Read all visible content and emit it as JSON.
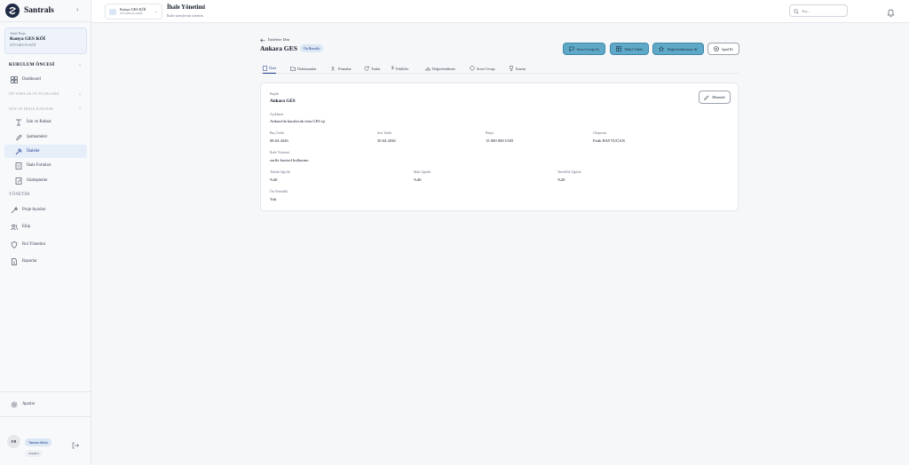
{
  "brand": {
    "name": "Santrals",
    "collapse_icon": "chevron-left-icon"
  },
  "sidebar": {
    "active_project": {
      "label": "Aktif Proje",
      "name": "Konya GES KÖİ",
      "code": "STT-GES-01-KÖİ"
    },
    "sections": {
      "kurulum": "KURULUM ÖNCESİ",
      "on_yapilar": "ÖN YAPILAR VE PLANLAMA",
      "izin": "İZİN VE İHALE KAPSAMI",
      "yonetim": "YÖNETİM"
    },
    "items": {
      "dashboard": "Dashboard",
      "izin_ruhsat": "İzin ve Ruhsat",
      "sartnameler": "Şartnameler",
      "ihaleler": "İhaleler",
      "ihale_formlari": "İhale Formları",
      "sozlesmeler": "Sözleşmeler",
      "proje_ayarlari": "Proje Ayarları",
      "ekip": "Ekip",
      "rol_yonetimi": "Rol Yönetimi",
      "raporlar": "Raporlar",
      "ayarlar": "Ayarlar"
    },
    "user": {
      "initials": "FB",
      "name": "Tamamı ödemi",
      "role": "Yönetici"
    }
  },
  "topbar": {
    "project_name": "Konya GES KÖİ",
    "project_code": "STT-GES-01-KÖİ",
    "title": "İhale Yönetimi",
    "subtitle": "İhale süreçlerini yönetin",
    "search_placeholder": "Ara..."
  },
  "main": {
    "back": "İhalelere Dön",
    "title": "Ankara GES",
    "status": "Ön Hazırlık",
    "actions": {
      "ask": "Soru-Cevap Aç",
      "sample_table": "Tablol Tablo",
      "evaluate": "Değerlendirmeye Al",
      "cancel": "İptal Et"
    },
    "tabs": {
      "ozet": "Özet",
      "dokumanlar": "Dokümanlar",
      "firmalar": "Firmalar",
      "turlar": "Turlar",
      "teklifler": "Teklifler",
      "degerlendirme": "Değerlendirme",
      "soru_cevap": "Soru-Cevap",
      "kazan": "Kazan"
    },
    "edit": "Düzenle",
    "fields": {
      "baslik_label": "Başlık",
      "baslik": "Ankara GES",
      "aciklama_label": "Açıklama",
      "aciklama": "Ankara'da kurulacak olan GES işi",
      "bas_tarih_label": "Baş Tarihi",
      "bas_tarih": "08.04.2026",
      "son_tarih_label": "Son Tarihi",
      "son_tarih": "30.04.2026",
      "butce_label": "Bütçe",
      "butce": "15 000 000 USD",
      "olusturan_label": "Oluşturan",
      "olusturan": "Fatih BAYTUĞAN",
      "ihale_yontemi_label": "İhale Yöntemi",
      "ihale_yontemi": "zarfla kontrol kullanımı",
      "teknik_label": "Teknik Ağırlık",
      "teknik": "%40",
      "mali_label": "Mali Ağırlık",
      "mali": "%40",
      "yeterlilik_label": "Yeterlilik Ağırlık",
      "yeterlilik": "%20",
      "on_yeterlilik_label": "Ön Yeterlilik",
      "on_yeterlilik": "Yok"
    }
  },
  "colors": {
    "accent": "#5fa8c7",
    "active_bg": "#e6eefa",
    "primary_text": "#1e3a8a"
  }
}
